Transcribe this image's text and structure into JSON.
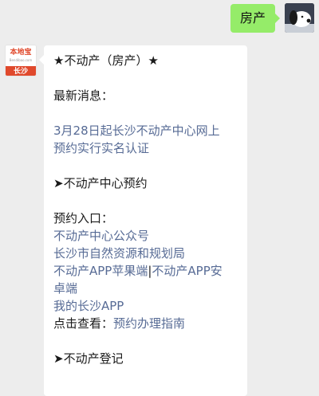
{
  "outgoing": {
    "text": "房产"
  },
  "sender": {
    "logo_name": "本地宝",
    "logo_url": "Bendibao.com",
    "logo_city": "长沙"
  },
  "message": {
    "title": "★不动产（房产）★",
    "news_label": "最新消息：",
    "news_link_1": "3月28日起长沙不动产中心网上",
    "news_link_2": "预约实行实名认证",
    "section_booking": "➤不动产中心预约",
    "entry_label": "预约入口：",
    "entry_link_1": "不动产中心公众号",
    "entry_link_2": "长沙市自然资源和规划局",
    "entry_link_3": "不动产APP苹果端",
    "entry_sep": "|",
    "entry_link_4a": "不动产APP安",
    "entry_link_4b": "卓端",
    "entry_link_5": "我的长沙APP",
    "guide_label": "点击查看：",
    "guide_link": "预约办理指南",
    "section_register": "➤不动产登记"
  }
}
